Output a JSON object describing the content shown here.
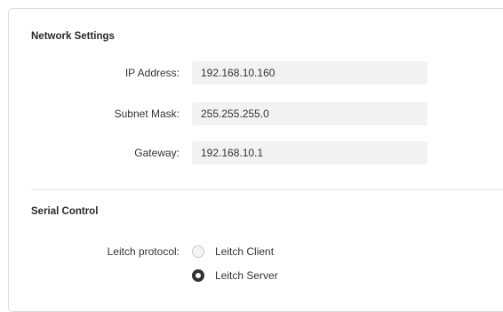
{
  "network": {
    "title": "Network Settings",
    "ip_label": "IP Address:",
    "ip_value": "192.168.10.160",
    "subnet_label": "Subnet Mask:",
    "subnet_value": "255.255.255.0",
    "gateway_label": "Gateway:",
    "gateway_value": "192.168.10.1"
  },
  "serial": {
    "title": "Serial Control",
    "protocol_label": "Leitch protocol:",
    "options": [
      {
        "label": "Leitch Client",
        "selected": false
      },
      {
        "label": "Leitch Server",
        "selected": true
      }
    ]
  }
}
